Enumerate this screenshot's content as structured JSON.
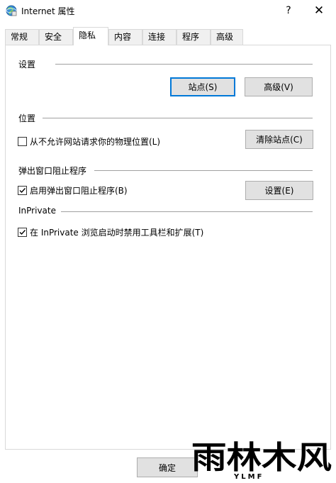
{
  "window": {
    "title": "Internet 属性",
    "help_label": "?",
    "close_label": "✕"
  },
  "tabs": [
    {
      "label": "常规",
      "active": false
    },
    {
      "label": "安全",
      "active": false
    },
    {
      "label": "隐私",
      "active": true
    },
    {
      "label": "内容",
      "active": false
    },
    {
      "label": "连接",
      "active": false
    },
    {
      "label": "程序",
      "active": false
    },
    {
      "label": "高级",
      "active": false
    }
  ],
  "settings": {
    "heading": "设置",
    "sites_button": "站点(S)",
    "advanced_button": "高级(V)"
  },
  "location": {
    "heading": "位置",
    "checkbox_label": "从不允许网站请求你的物理位置(L)",
    "checked": false,
    "clear_sites_button": "清除站点(C)"
  },
  "popup_blocker": {
    "heading": "弹出窗口阻止程序",
    "checkbox_label": "启用弹出窗口阻止程序(B)",
    "checked": true,
    "settings_button": "设置(E)"
  },
  "inprivate": {
    "heading": "InPrivate",
    "checkbox_label": "在 InPrivate 浏览启动时禁用工具栏和扩展(T)",
    "checked": true
  },
  "footer": {
    "ok_button": "确定"
  },
  "watermark": {
    "main_text": "雨林木风",
    "sub_text": "YLMF"
  },
  "colors": {
    "focus_blue": "#0078d7",
    "button_face": "#e1e1e1",
    "tab_face": "#f0f0f0"
  }
}
